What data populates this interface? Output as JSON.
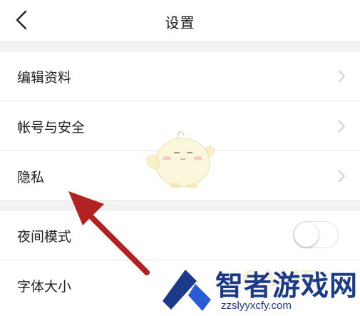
{
  "header": {
    "title": "设置",
    "back_icon": "chevron-left-icon"
  },
  "groups": [
    {
      "items": [
        {
          "label": "编辑资料",
          "trailing": "chevron-right-icon"
        },
        {
          "label": "帐号与安全",
          "trailing": "chevron-right-icon"
        },
        {
          "label": "隐私",
          "trailing": "chevron-right-icon"
        }
      ]
    },
    {
      "items": [
        {
          "label": "夜间模式",
          "toggle_on": false
        },
        {
          "label": "字体大小"
        }
      ]
    }
  ],
  "annotation": {
    "arrow_color": "#b22222",
    "points_to": "隐私"
  },
  "watermark": {
    "brand": "智者游戏网",
    "sub_brand": "GAME",
    "url": "zzslyyxcfy.com",
    "color": "#1c3a8a"
  },
  "colors": {
    "background": "#f2f2f2",
    "surface": "#ffffff",
    "divider": "#e6e6e6",
    "chevron": "#c8c8c8"
  }
}
